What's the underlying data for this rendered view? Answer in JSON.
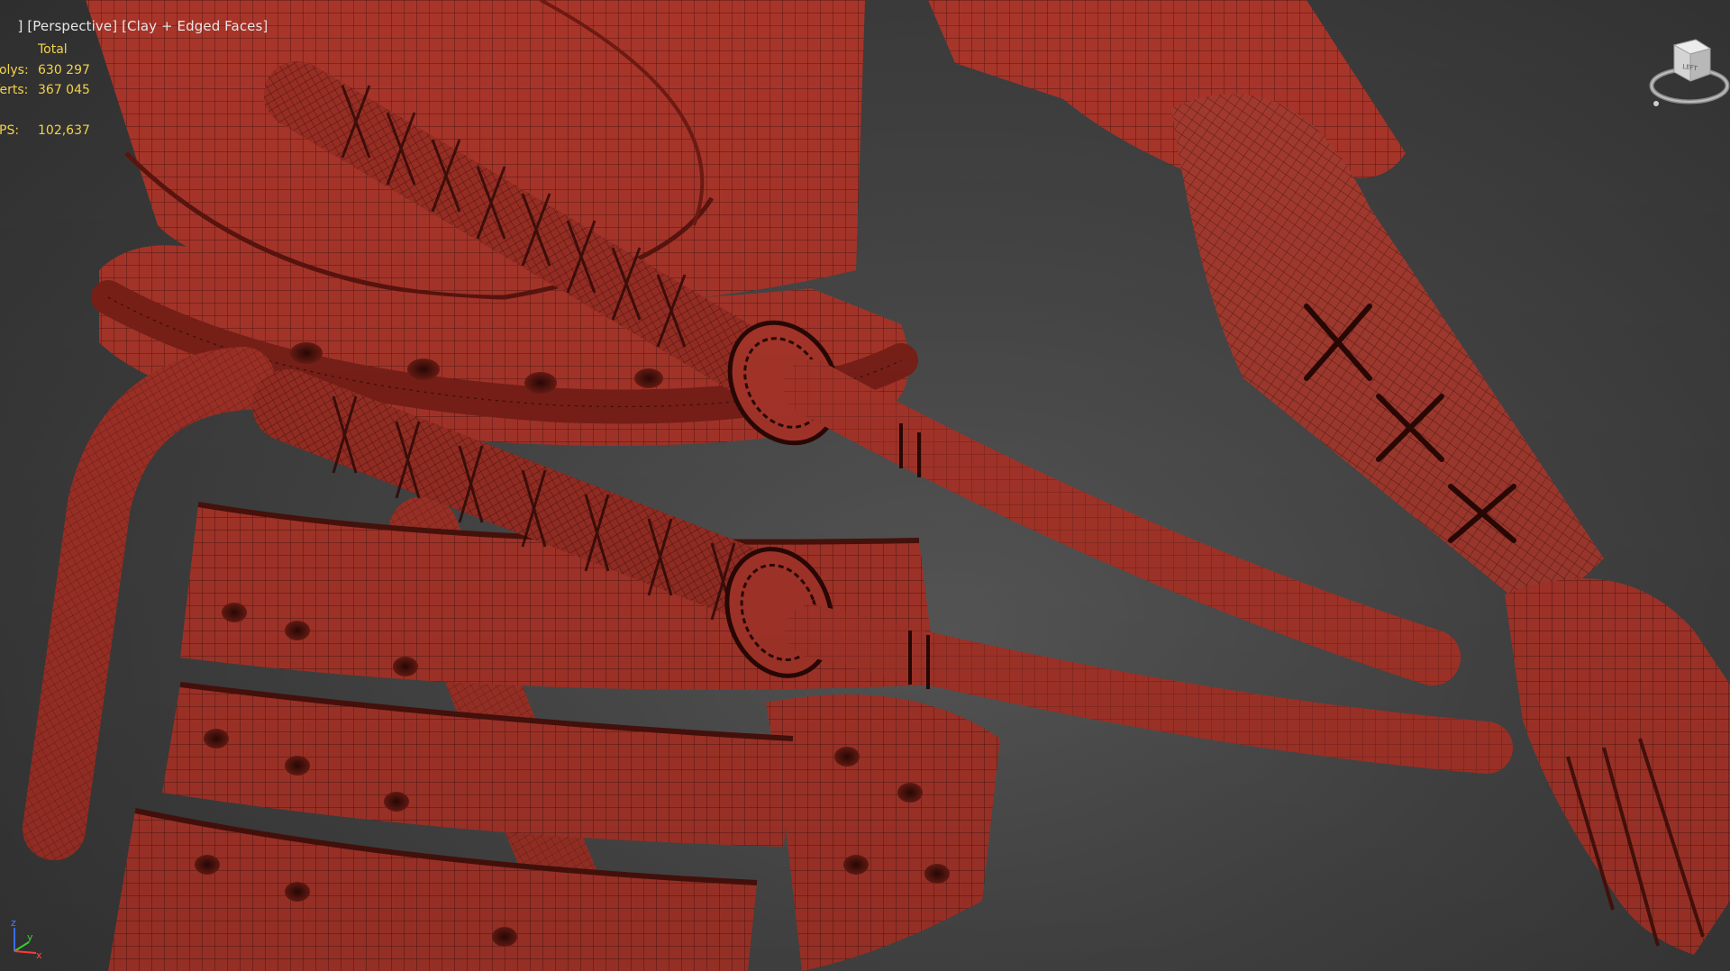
{
  "viewport": {
    "label_parts": [
      "]",
      "[Perspective]",
      "[Clay + Edged Faces]"
    ],
    "render_mode": "Clay + Edged Faces",
    "view": "Perspective"
  },
  "stats": {
    "header": "Total",
    "polys_label": "Polys:",
    "polys_value": "630 297",
    "verts_label": "Verts:",
    "verts_value": "367 045",
    "fps_label": "FPS:",
    "fps_value": "102,637"
  },
  "viewcube": {
    "face_label": "LEFT",
    "icon": "viewcube-icon"
  },
  "axis": {
    "icon": "axis-tripod-icon",
    "labels": [
      "z",
      "y",
      "x"
    ]
  },
  "colors": {
    "stats_text": "#f2d24a",
    "label_text": "#e6e6e6",
    "clay": "#a8352a",
    "wire": "#3a0f0a",
    "background": "#464646"
  }
}
